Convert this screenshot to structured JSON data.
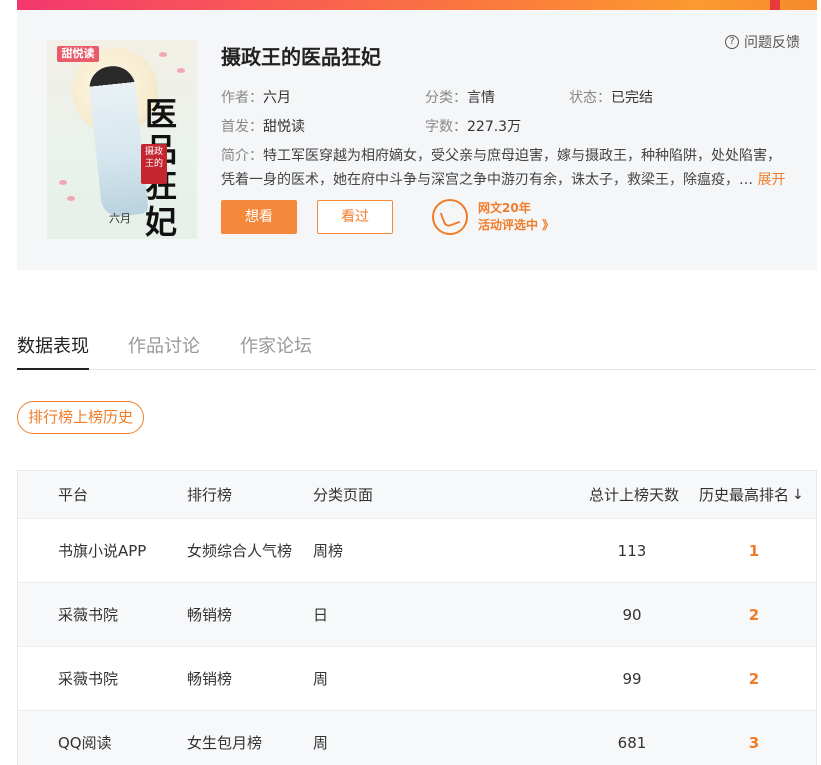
{
  "book": {
    "title": "摄政王的医品狂妃",
    "cover": {
      "logo": "甜悦读",
      "title_art": "医品狂妃",
      "seal_text": "摄政王的",
      "author_mark": "六月"
    },
    "feedback_label": "问题反馈",
    "author_key": "作者：",
    "author": "六月",
    "category_key": "分类：",
    "category": "言情",
    "status_key": "状态：",
    "status": "已完结",
    "first_pub_key": "首发：",
    "first_pub": "甜悦读",
    "word_count_key": "字数：",
    "word_count": "227.3万",
    "intro_key": "简介：",
    "intro_line1": "特工军医穿越为相府嫡女，受父亲与庶母迫害，嫁与摄政王，种种陷阱，处处陷害，",
    "intro_line2": "凭着一身的医术，她在府中斗争与深宫之争中游刃有余，诛太子，救梁王，除瘟疫，…",
    "expand_label": "展开",
    "want_read_label": "想看",
    "have_read_label": "看过",
    "promo_line1": "网文20年",
    "promo_line2": "活动评选中 》"
  },
  "tabs": [
    {
      "label": "数据表现",
      "active": true
    },
    {
      "label": "作品讨论",
      "active": false
    },
    {
      "label": "作家论坛",
      "active": false
    }
  ],
  "history_pill": "排行榜上榜历史",
  "table": {
    "headers": {
      "platform": "平台",
      "chart": "排行榜",
      "page": "分类页面",
      "days": "总计上榜天数",
      "rank": "历史最高排名"
    },
    "rows": [
      {
        "platform": "书旗小说APP",
        "chart": "女频综合人气榜",
        "page": "周榜",
        "days": "113",
        "rank": "1"
      },
      {
        "platform": "采薇书院",
        "chart": "畅销榜",
        "page": "日",
        "days": "90",
        "rank": "2"
      },
      {
        "platform": "采薇书院",
        "chart": "畅销榜",
        "page": "周",
        "days": "99",
        "rank": "2"
      },
      {
        "platform": "QQ阅读",
        "chart": "女生包月榜",
        "page": "周",
        "days": "681",
        "rank": "3"
      }
    ]
  },
  "colors": {
    "accent": "#f07c2a",
    "accent_button": "#f4893b",
    "card_bg": "#f5f6f8"
  }
}
